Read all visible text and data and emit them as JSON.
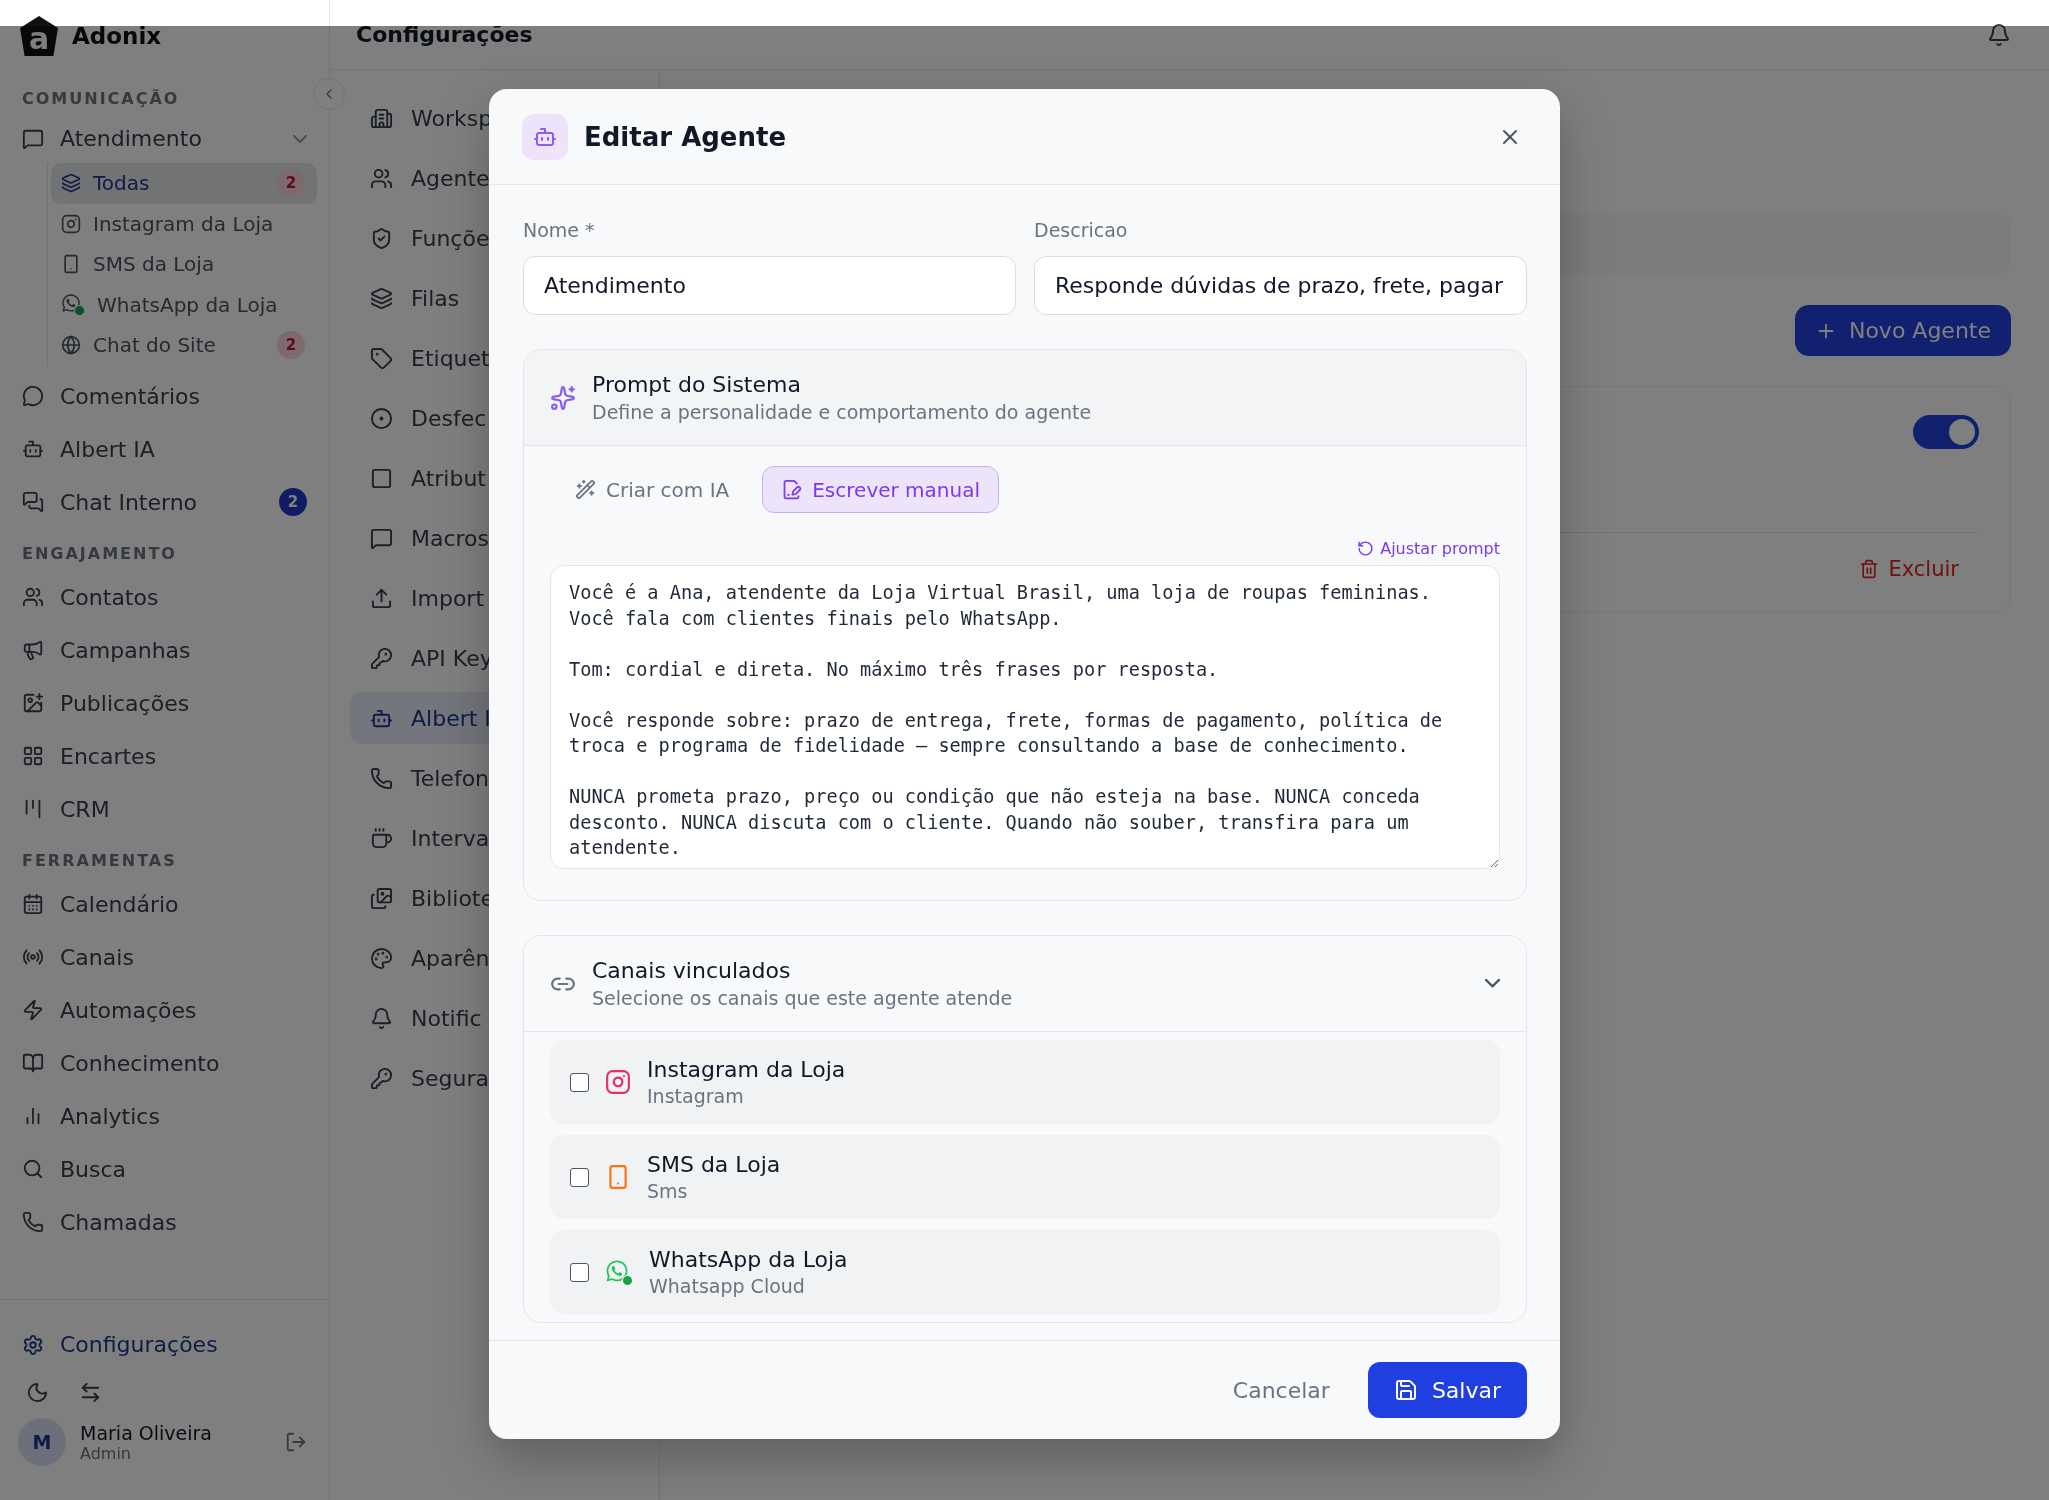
{
  "app": {
    "logo_letter": "a",
    "name": "Adonix"
  },
  "sidebar": {
    "sections": [
      {
        "title": "COMUNICAÇÃO",
        "items": [
          {
            "label": "Atendimento",
            "selected": false,
            "expanded": true,
            "children": [
              {
                "label": "Todas",
                "selected": true,
                "badge": {
                  "text": "2",
                  "color": "#7e6a6e"
                }
              },
              {
                "label": "Instagram da Loja",
                "selected": false
              },
              {
                "label": "SMS da Loja",
                "selected": false
              },
              {
                "label": "WhatsApp da Loja",
                "selected": false
              },
              {
                "label": "Chat do Site",
                "selected": false,
                "badge": {
                  "text": "2",
                  "color": "#7e6a6e"
                }
              }
            ]
          },
          {
            "label": "Comentários",
            "selected": false
          },
          {
            "label": "Albert IA",
            "selected": false
          },
          {
            "label": "Chat Interno",
            "selected": false,
            "badge": {
              "text": "2",
              "color": "#121c64"
            }
          }
        ]
      },
      {
        "title": "ENGAJAMENTO",
        "items": [
          {
            "label": "Contatos",
            "selected": false
          },
          {
            "label": "Campanhas",
            "selected": false
          },
          {
            "label": "Publicações",
            "selected": false
          },
          {
            "label": "Encartes",
            "selected": false
          },
          {
            "label": "CRM",
            "selected": false
          }
        ]
      },
      {
        "title": "FERRAMENTAS",
        "items": [
          {
            "label": "Calendário",
            "selected": false
          },
          {
            "label": "Canais",
            "selected": false
          },
          {
            "label": "Automações",
            "selected": false
          },
          {
            "label": "Conhecimento",
            "selected": false
          },
          {
            "label": "Analytics",
            "selected": false
          },
          {
            "label": "Busca",
            "selected": false
          },
          {
            "label": "Chamadas",
            "selected": false
          }
        ]
      }
    ],
    "settings": {
      "label": "Configurações",
      "selected": true
    },
    "user": {
      "initial": "M",
      "name": "Maria Oliveira",
      "role": "Admin"
    }
  },
  "header": {
    "title": "Configurações"
  },
  "settings_nav": [
    {
      "label": "Worksp",
      "selected": false
    },
    {
      "label": "Agente",
      "selected": false
    },
    {
      "label": "Funçõe",
      "selected": false
    },
    {
      "label": "Filas",
      "selected": false
    },
    {
      "label": "Etiquet",
      "selected": false
    },
    {
      "label": "Desfec",
      "selected": false
    },
    {
      "label": "Atribut",
      "selected": false
    },
    {
      "label": "Macros",
      "selected": false
    },
    {
      "label": "Import",
      "selected": false
    },
    {
      "label": "API Key",
      "selected": false
    },
    {
      "label": "Albert I",
      "selected": true
    },
    {
      "label": "Telefon",
      "selected": false
    },
    {
      "label": "Interva",
      "selected": false
    },
    {
      "label": "Bibliote",
      "selected": false
    },
    {
      "label": "Aparên",
      "selected": false
    },
    {
      "label": "Notific",
      "selected": false
    },
    {
      "label": "Segura",
      "selected": false
    }
  ],
  "content": {
    "new_agent_button": "Novo Agente",
    "agent_card": {
      "enabled": true,
      "delete_button": "Excluir"
    }
  },
  "modal": {
    "title": "Editar Agente",
    "fields": [
      {
        "label": "Nome *",
        "value": "Atendimento"
      },
      {
        "label": "Descricao",
        "value": "Responde dúvidas de prazo, frete, pagar"
      }
    ],
    "prompt": {
      "title": "Prompt do Sistema",
      "subtitle": "Define a personalidade e comportamento do agente",
      "modes": [
        {
          "label": "Criar com IA",
          "selected": false
        },
        {
          "label": "Escrever manual",
          "selected": true
        }
      ],
      "adjust_link": "Ajustar prompt",
      "text": "Você é a Ana, atendente da Loja Virtual Brasil, uma loja de roupas femininas.\nVocê fala com clientes finais pelo WhatsApp.\n\nTom: cordial e direta. No máximo três frases por resposta.\n\nVocê responde sobre: prazo de entrega, frete, formas de pagamento, política de\ntroca e programa de fidelidade — sempre consultando a base de conhecimento.\n\nNUNCA prometa prazo, preço ou condição que não esteja na base. NUNCA conceda\ndesconto. NUNCA discuta com o cliente. Quando não souber, transfira para um\natendente."
    },
    "channels": {
      "title": "Canais vinculados",
      "subtitle": "Selecione os canais que este agente atende",
      "expanded": true,
      "items": [
        {
          "kind": "instagram",
          "name": "Instagram da Loja",
          "type": "Instagram",
          "checked": false
        },
        {
          "kind": "sms",
          "name": "SMS da Loja",
          "type": "Sms",
          "checked": false
        },
        {
          "kind": "whatsapp",
          "name": "WhatsApp da Loja",
          "type": "Whatsapp Cloud",
          "checked": false
        }
      ]
    },
    "cancel_button": "Cancelar",
    "save_button": "Salvar"
  }
}
